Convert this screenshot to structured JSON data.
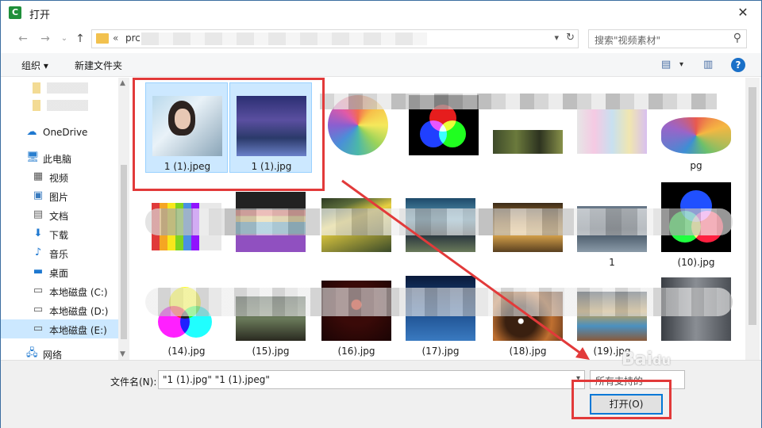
{
  "window": {
    "title": "打开",
    "app_logo": "C",
    "close_glyph": "✕"
  },
  "nav": {
    "back_glyph": "←",
    "forward_glyph": "→",
    "recent_glyph": "⌄",
    "up_glyph": "↑",
    "path_prefix": "«",
    "path_text": "prc",
    "search_placeholder": "搜索\"视频素材\""
  },
  "toolbar": {
    "organize_label": "组织 ▾",
    "new_folder_label": "新建文件夹"
  },
  "sidebar": {
    "items": [
      {
        "label": "OneDrive",
        "icon": "cloud-icon"
      },
      {
        "label": "此电脑",
        "icon": "computer-icon"
      },
      {
        "label": "视频",
        "icon": "video-icon"
      },
      {
        "label": "图片",
        "icon": "pictures-icon"
      },
      {
        "label": "文档",
        "icon": "documents-icon"
      },
      {
        "label": "下载",
        "icon": "download-icon"
      },
      {
        "label": "音乐",
        "icon": "music-icon"
      },
      {
        "label": "桌面",
        "icon": "desktop-icon"
      },
      {
        "label": "本地磁盘 (C:)",
        "icon": "drive-icon"
      },
      {
        "label": "本地磁盘 (D:)",
        "icon": "drive-icon"
      },
      {
        "label": "本地磁盘 (E:)",
        "icon": "drive-icon",
        "selected": true
      },
      {
        "label": "网络",
        "icon": "network-icon"
      }
    ]
  },
  "files": [
    {
      "name": "1 (1).jpeg",
      "selected": true
    },
    {
      "name": "1 (1).jpg",
      "selected": true
    },
    {
      "name": ""
    },
    {
      "name": ""
    },
    {
      "name": ""
    },
    {
      "name": ""
    },
    {
      "name": "pg"
    },
    {
      "name": ""
    },
    {
      "name": ""
    },
    {
      "name": ""
    },
    {
      "name": ""
    },
    {
      "name": ""
    },
    {
      "name": "1"
    },
    {
      "name": "(10).jpg"
    },
    {
      "name": "(14).jpg"
    },
    {
      "name": "(15).jpg"
    },
    {
      "name": "(16).jpg"
    },
    {
      "name": "(17).jpg"
    },
    {
      "name": "(18).jpg"
    },
    {
      "name": "(19).jpg"
    },
    {
      "name": ""
    }
  ],
  "footer": {
    "filename_label": "文件名(N):",
    "filename_value": "\"1 (1).jpg\" \"1 (1).jpeg\"",
    "filetype_value": "所有支持的",
    "open_label": "打开(O)"
  },
  "watermark": "Baidu"
}
